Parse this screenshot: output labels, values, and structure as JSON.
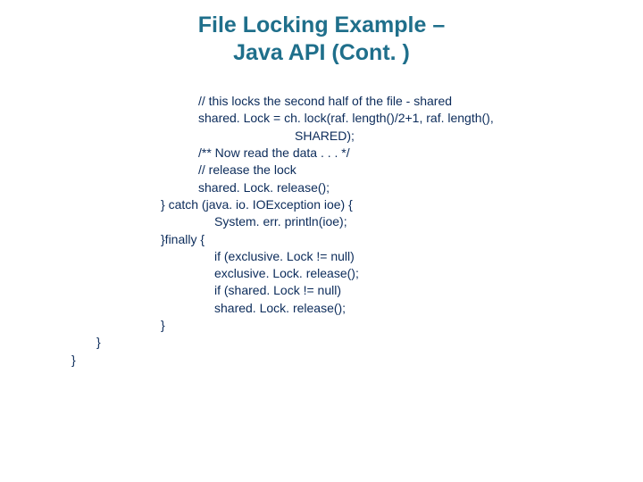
{
  "title": {
    "line1": "File Locking Example –",
    "line2": "Java API (Cont. )"
  },
  "code": {
    "l01": "// this locks the second half of the file - shared",
    "l02": "shared. Lock = ch. lock(raf. length()/2+1, raf. length(),",
    "l03": "SHARED);",
    "l04": "/** Now read the data . . . */",
    "l05": "// release the lock",
    "l06": "shared. Lock. release();",
    "l07": "} catch (java. io. IOException ioe) {",
    "l08": "System. err. println(ioe);",
    "l09": "}finally {",
    "l10": "if (exclusive. Lock != null)",
    "l11": "exclusive. Lock. release();",
    "l12": "if (shared. Lock != null)",
    "l13": "shared. Lock. release();",
    "l14": "}",
    "l15": "}",
    "l16": "}"
  }
}
